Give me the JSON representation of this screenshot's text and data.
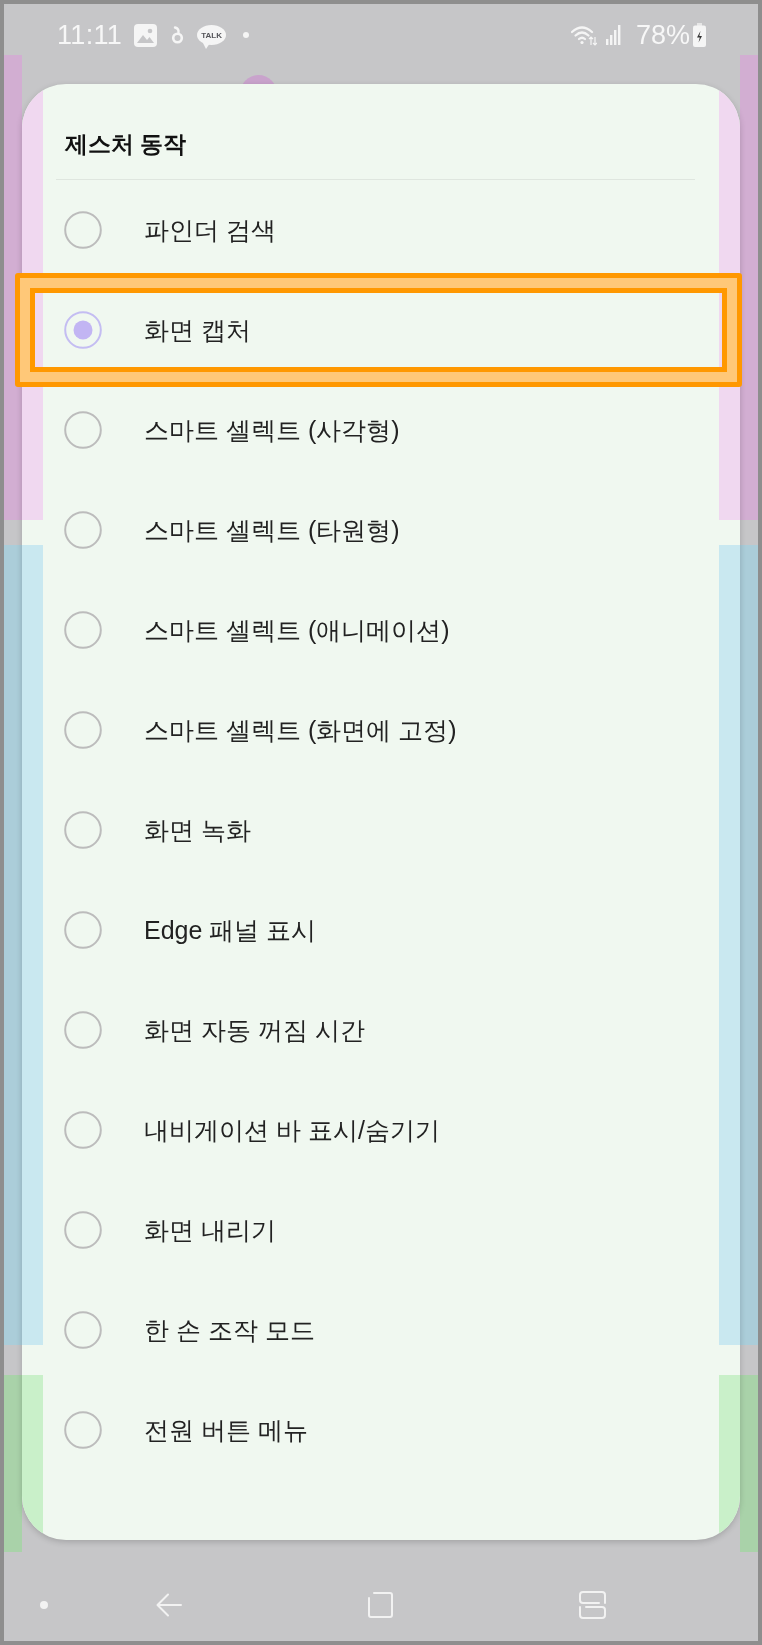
{
  "status_bar": {
    "time": "11:11",
    "chat_badge": "TALK",
    "battery_percent": "78%"
  },
  "dialog": {
    "title": "제스처 동작",
    "options": [
      {
        "label": "파인더 검색",
        "selected": false,
        "highlighted": false
      },
      {
        "label": "화면 캡처",
        "selected": true,
        "highlighted": true
      },
      {
        "label": "스마트 셀렉트 (사각형)",
        "selected": false,
        "highlighted": false
      },
      {
        "label": "스마트 셀렉트 (타원형)",
        "selected": false,
        "highlighted": false
      },
      {
        "label": "스마트 셀렉트 (애니메이션)",
        "selected": false,
        "highlighted": false
      },
      {
        "label": "스마트 셀렉트 (화면에 고정)",
        "selected": false,
        "highlighted": false
      },
      {
        "label": "화면 녹화",
        "selected": false,
        "highlighted": false
      },
      {
        "label": "Edge 패널 표시",
        "selected": false,
        "highlighted": false
      },
      {
        "label": "화면 자동 꺼짐 시간",
        "selected": false,
        "highlighted": false
      },
      {
        "label": "내비게이션 바 표시/숨기기",
        "selected": false,
        "highlighted": false
      },
      {
        "label": "화면 내리기",
        "selected": false,
        "highlighted": false
      },
      {
        "label": "한 손 조작 모드",
        "selected": false,
        "highlighted": false
      },
      {
        "label": "전원 버튼 메뉴",
        "selected": false,
        "highlighted": false
      }
    ]
  }
}
